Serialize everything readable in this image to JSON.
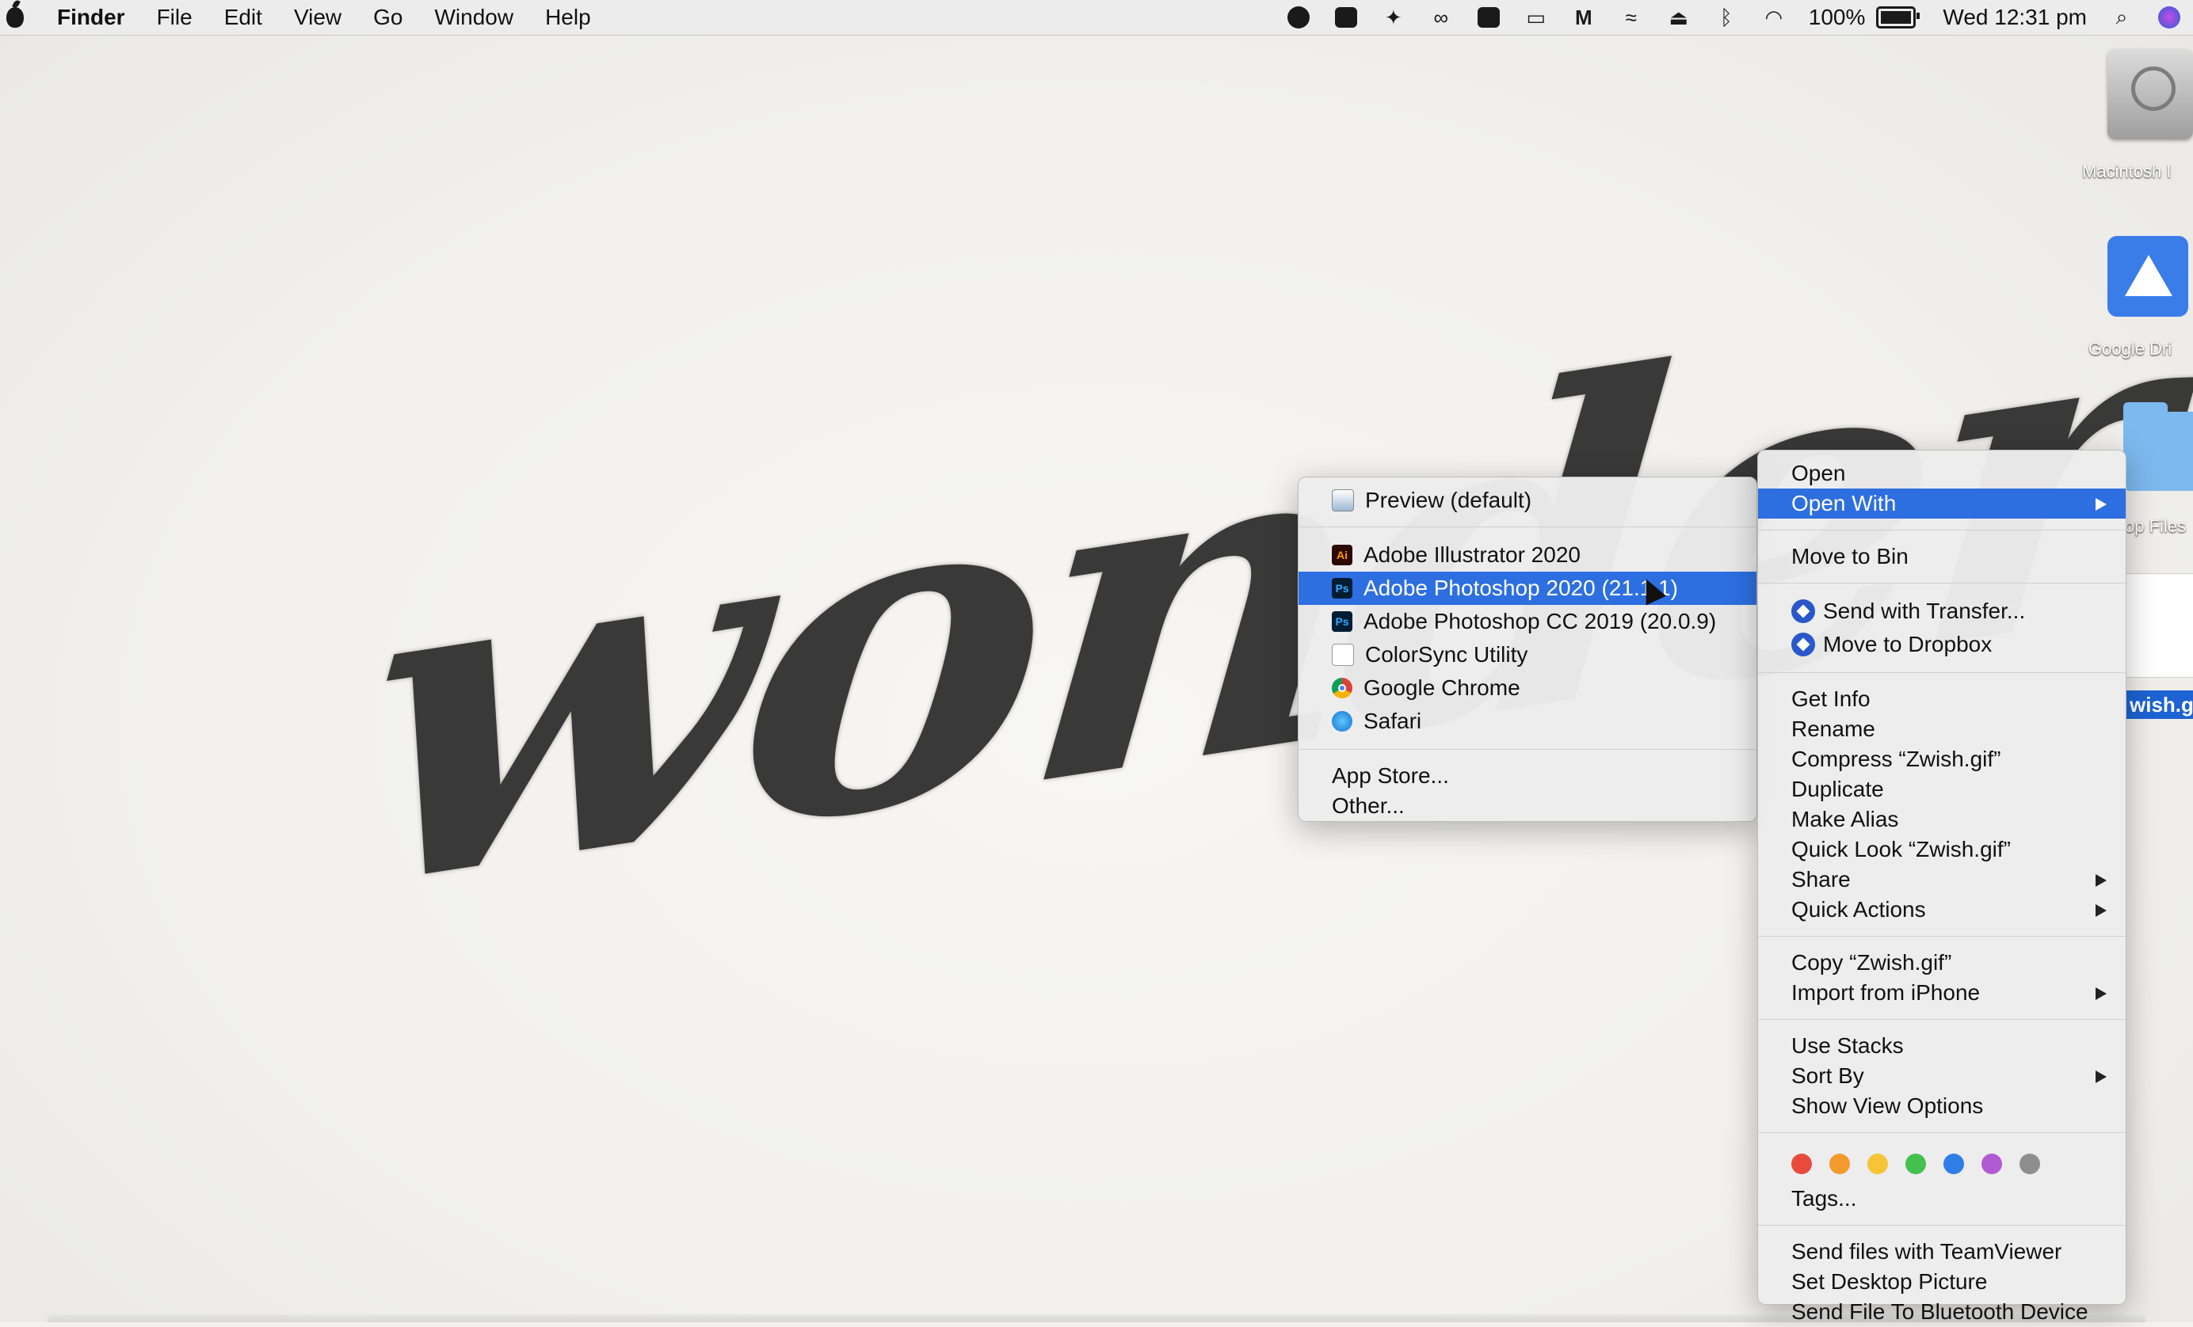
{
  "menubar": {
    "app_name": "Finder",
    "items": [
      "File",
      "Edit",
      "View",
      "Go",
      "Window",
      "Help"
    ],
    "battery": "100%",
    "clock": "Wed 12:31 pm",
    "status_icons": [
      "screen-record-icon",
      "video-icon",
      "dropbox-icon",
      "creative-cloud-icon",
      "adobe-icon",
      "display-icon",
      "m-icon",
      "wave-icon",
      "airplay-icon",
      "bluetooth-icon",
      "wifi-icon"
    ]
  },
  "desktop": {
    "wallpaper_text": "wonder",
    "icons": {
      "hd": "Macintosh I",
      "gdrive": "Google Dri",
      "folder": "op Files",
      "file": "wish.gif"
    }
  },
  "open_with_menu": {
    "items": [
      {
        "label": "Preview (default)",
        "icon": "preview-icon"
      },
      {
        "label": "Adobe Illustrator 2020",
        "icon": "illustrator-icon",
        "icon_text": "Ai"
      },
      {
        "label": "Adobe Photoshop 2020 (21.1.1)",
        "icon": "photoshop-icon",
        "icon_text": "Ps",
        "highlighted": true
      },
      {
        "label": "Adobe Photoshop CC 2019 (20.0.9)",
        "icon": "photoshop-icon",
        "icon_text": "Ps"
      },
      {
        "label": "ColorSync Utility",
        "icon": "colorsync-icon"
      },
      {
        "label": "Google Chrome",
        "icon": "chrome-icon"
      },
      {
        "label": "Safari",
        "icon": "safari-icon"
      }
    ],
    "footer": [
      "App Store...",
      "Other..."
    ]
  },
  "context_menu": {
    "open": "Open",
    "open_with": "Open With",
    "move_to_bin": "Move to Bin",
    "send_transfer": "Send with Transfer...",
    "move_dropbox": "Move to Dropbox",
    "group3": [
      "Get Info",
      "Rename",
      "Compress “Zwish.gif”",
      "Duplicate",
      "Make Alias",
      "Quick Look “Zwish.gif”"
    ],
    "share": "Share",
    "quick_actions": "Quick Actions",
    "copy": "Copy “Zwish.gif”",
    "import_iphone": "Import from iPhone",
    "use_stacks": "Use Stacks",
    "sort_by": "Sort By",
    "show_view_options": "Show View Options",
    "tag_colors": [
      "#e84b3c",
      "#f39a2f",
      "#f6c436",
      "#44c04f",
      "#2f7ee8",
      "#b05ad3",
      "#8e8e8e"
    ],
    "tags": "Tags...",
    "bottom": [
      "Send files with TeamViewer",
      "Set Desktop Picture",
      "Send File To Bluetooth Device"
    ]
  }
}
